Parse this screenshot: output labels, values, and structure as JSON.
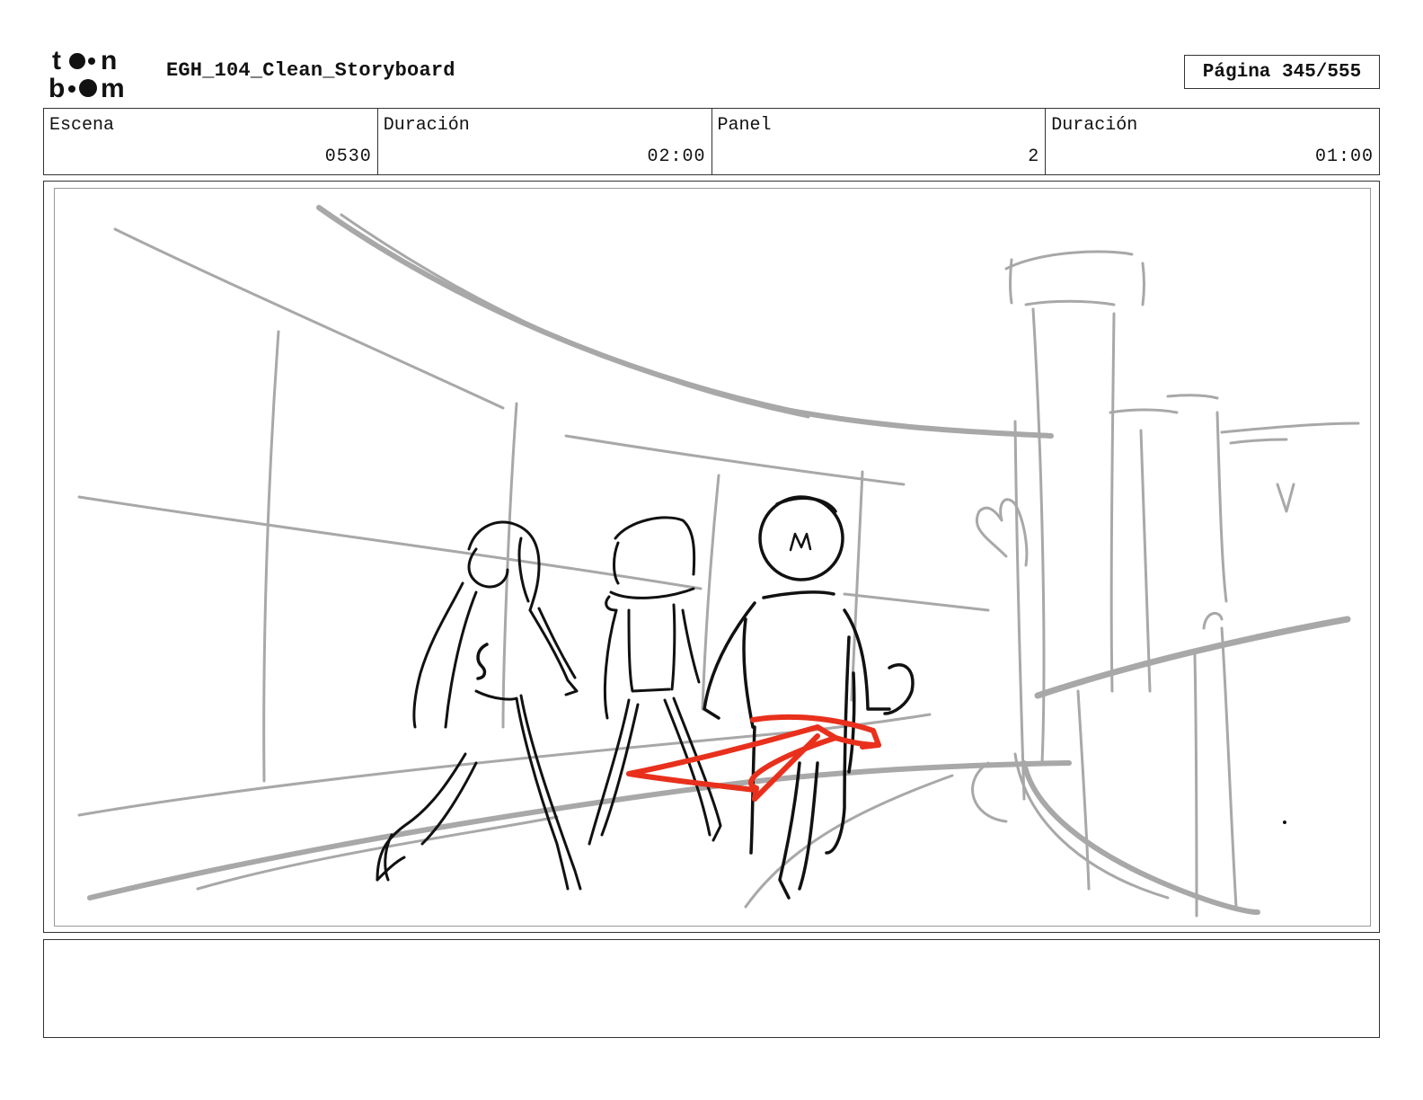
{
  "header": {
    "logo_text": "toon boom",
    "document_title": "EGH_104_Clean_Storyboard",
    "page_label": "Página 345/555"
  },
  "info": [
    {
      "label": "Escena",
      "value": "0530"
    },
    {
      "label": "Duración",
      "value": "02:00"
    },
    {
      "label": "Panel",
      "value": "2"
    },
    {
      "label": "Duración",
      "value": "01:00"
    }
  ],
  "panel": {
    "characters": [
      "S",
      "M"
    ],
    "colors": {
      "sketch_gray": "#a8a8a8",
      "ink": "#111111",
      "arrow_red": "#e8301c"
    }
  },
  "notes": {
    "text": ""
  }
}
